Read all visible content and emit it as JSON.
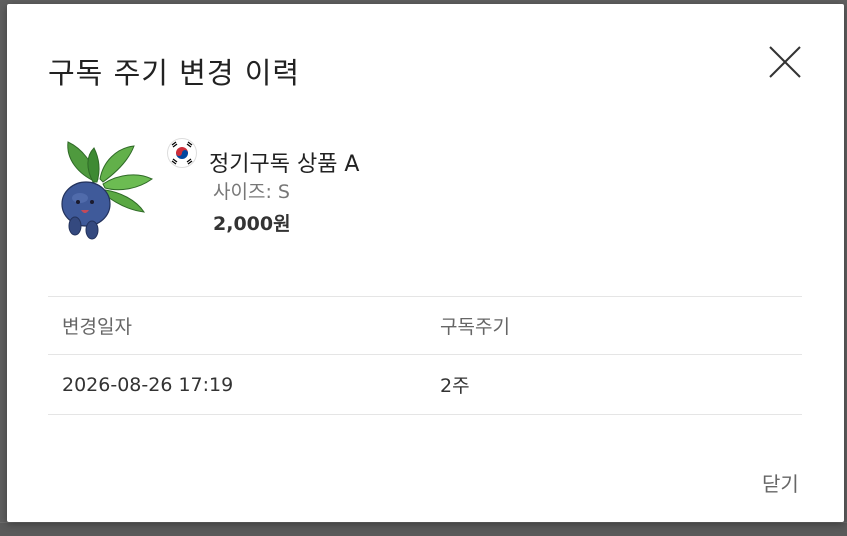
{
  "modal": {
    "title": "구독 주기 변경 이력",
    "close_label": "닫기"
  },
  "product": {
    "name": "정기구독 상품 A",
    "size": "사이즈: S",
    "price": "2,000원",
    "flag_icon": "south-korea-flag-icon",
    "image_icon": "plant-bulb-creature-icon"
  },
  "history": {
    "columns": [
      "변경일자",
      "구독주기"
    ],
    "rows": [
      [
        "2026-08-26 17:19",
        "2주"
      ]
    ]
  },
  "colors": {
    "overlay": "#5d5d5d",
    "modal_bg": "#ffffff",
    "divider": "#e5e5e5",
    "text_primary": "#222222",
    "text_secondary": "#777777"
  }
}
